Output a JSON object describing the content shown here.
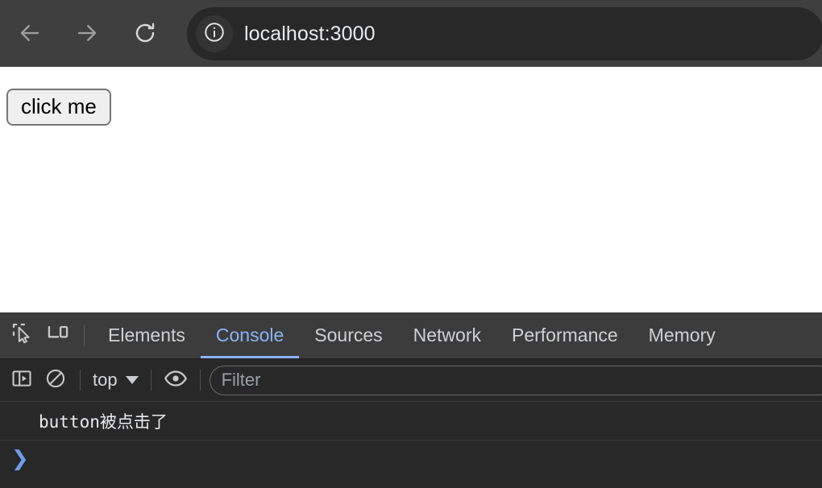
{
  "browser": {
    "back_icon": "arrow-left-icon",
    "forward_icon": "arrow-right-icon",
    "reload_icon": "reload-icon",
    "site_info_icon": "info-circle-icon",
    "url": "localhost:3000",
    "chrome_bg": "#3f3f3f",
    "omnibox_bg": "#282828"
  },
  "page": {
    "button_label": "click me",
    "background": "#ffffff"
  },
  "devtools": {
    "inspect_icon": "inspect-element-icon",
    "device_toggle_icon": "device-toolbar-icon",
    "tabs": [
      {
        "label": "Elements",
        "active": false
      },
      {
        "label": "Console",
        "active": true
      },
      {
        "label": "Sources",
        "active": false
      },
      {
        "label": "Network",
        "active": false
      },
      {
        "label": "Performance",
        "active": false
      },
      {
        "label": "Memory",
        "active": false
      }
    ],
    "active_tab_color": "#8ab4f8",
    "tabbar_bg": "#3c3c3c",
    "console_toolbar": {
      "sidebar_icon": "console-sidebar-toggle-icon",
      "clear_icon": "clear-console-icon",
      "context_label": "top",
      "context_caret_icon": "chevron-down-icon",
      "eye_icon": "live-expression-eye-icon",
      "filter_placeholder": "Filter",
      "filter_value": ""
    },
    "console_output": {
      "messages": [
        {
          "text": "button被点击了",
          "level": "log"
        }
      ],
      "prompt_symbol": "❯",
      "prompt_value": "",
      "prompt_color": "#6d9eeb",
      "background": "#282828"
    }
  }
}
